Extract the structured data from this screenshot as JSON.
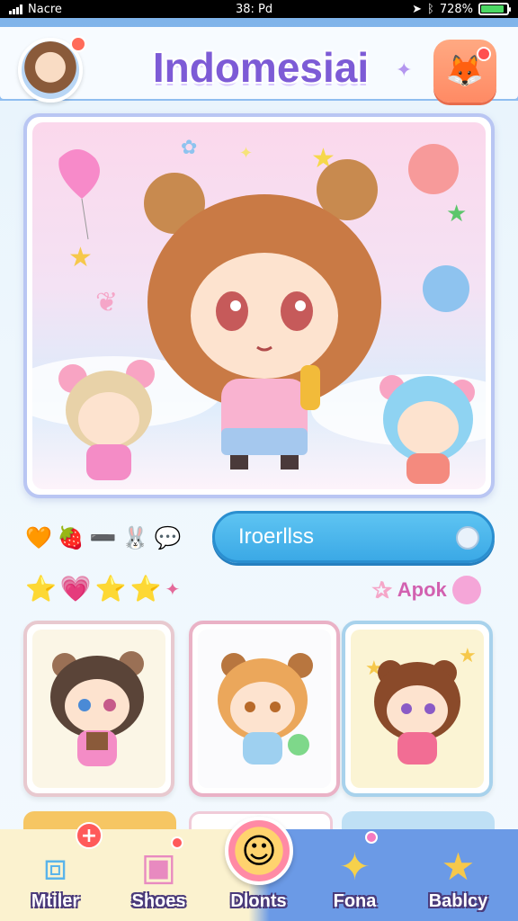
{
  "status_bar": {
    "carrier": "Nacre",
    "time": "38: Pd",
    "battery_text": "728%",
    "battery_fraction": 0.9,
    "accent": "#4cd964"
  },
  "header": {
    "title": "Indomesiai",
    "avatar_icon": "avatar-girl-icon",
    "fox_icon": "fox-icon",
    "title_color": "#7d5bd6",
    "fox_color": "#ff8a64"
  },
  "hero": {
    "description_icon": "chibi-characters-illustration"
  },
  "search": {
    "value": "Iroerllss",
    "color": "#3ba9e6"
  },
  "icon_row": [
    "🧡",
    "🍓",
    "➖",
    "🐰",
    "💬"
  ],
  "star_row": [
    "⭐",
    "💗",
    "⭐",
    "⭐",
    "✦"
  ],
  "apok": {
    "label": "Apok",
    "icon": "✰"
  },
  "cards": [
    {
      "name": "bear-girl-card",
      "accent": "#e8c9cf"
    },
    {
      "name": "blonde-girl-card",
      "accent": "#eab2c6"
    },
    {
      "name": "brown-girl-card",
      "accent": "#a8d2ec"
    }
  ],
  "nav": {
    "items": [
      {
        "label": "Mtiler",
        "icon": "cube-icon"
      },
      {
        "label": "Shoes",
        "icon": "box-icon"
      },
      {
        "label": "Dlonts",
        "icon": "smile-icon"
      },
      {
        "label": "Fona",
        "icon": "cat-icon"
      },
      {
        "label": "Bablcy",
        "icon": "star-icon"
      }
    ]
  }
}
